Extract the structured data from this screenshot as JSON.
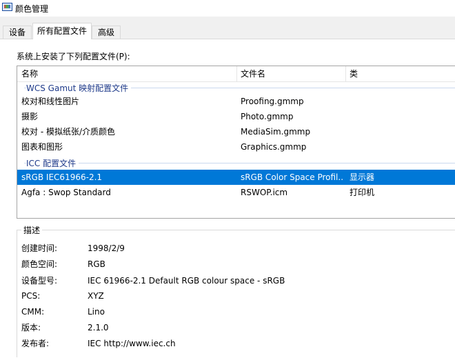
{
  "window": {
    "title": "颜色管理",
    "icon": "color-management-icon"
  },
  "tabs": [
    {
      "label": "设备",
      "active": false
    },
    {
      "label": "所有配置文件",
      "active": true
    },
    {
      "label": "高级",
      "active": false
    }
  ],
  "installed_label": "系统上安装了下列配置文件(P):",
  "columns": {
    "name": "名称",
    "file": "文件名",
    "class": "类"
  },
  "groups": [
    {
      "label": "WCS Gamut 映射配置文件",
      "rows": [
        {
          "name": "校对和线性图片",
          "file": "Proofing.gmmp",
          "class": ""
        },
        {
          "name": "摄影",
          "file": "Photo.gmmp",
          "class": ""
        },
        {
          "name": "校对 - 模拟纸张/介质颜色",
          "file": "MediaSim.gmmp",
          "class": ""
        },
        {
          "name": "图表和图形",
          "file": "Graphics.gmmp",
          "class": ""
        }
      ]
    },
    {
      "label": "ICC 配置文件",
      "rows": [
        {
          "name": "sRGB IEC61966-2.1",
          "file": "sRGB Color Space Profil...",
          "class": "显示器",
          "selected": true
        },
        {
          "name": "Agfa : Swop Standard",
          "file": "RSWOP.icm",
          "class": "打印机"
        }
      ]
    }
  ],
  "description": {
    "legend": "描述",
    "fields": [
      {
        "label": "创建时间:",
        "value": "1998/2/9"
      },
      {
        "label": "颜色空间:",
        "value": "RGB"
      },
      {
        "label": "设备型号:",
        "value": "IEC 61966-2.1 Default RGB colour space - sRGB"
      },
      {
        "label": "PCS:",
        "value": "XYZ"
      },
      {
        "label": "CMM:",
        "value": "Lino"
      },
      {
        "label": "版本:",
        "value": "2.1.0"
      },
      {
        "label": "发布者:",
        "value": "IEC http://www.iec.ch"
      }
    ]
  },
  "colors": {
    "selection": "#0078d7",
    "group_text": "#1e3a8a"
  }
}
